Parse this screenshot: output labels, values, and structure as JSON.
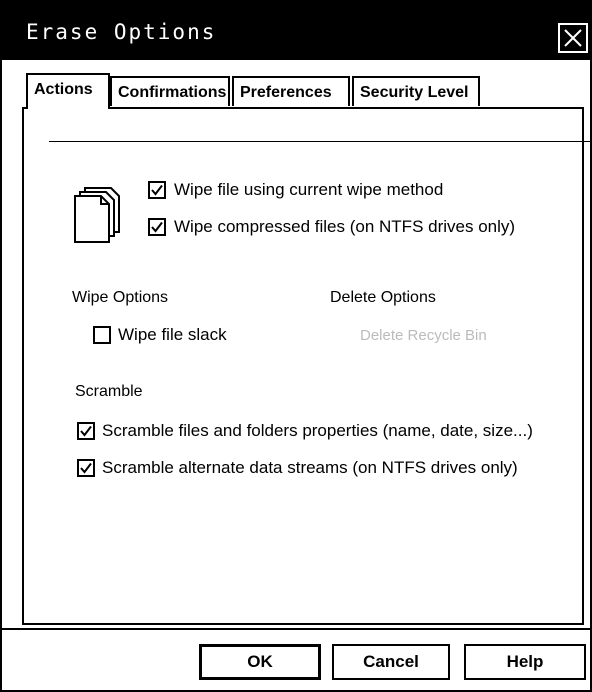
{
  "window": {
    "title": "Erase Options"
  },
  "tabs": [
    {
      "label": "Actions",
      "active": true
    },
    {
      "label": "Confirmations",
      "active": false
    },
    {
      "label": "Preferences",
      "active": false
    },
    {
      "label": "Security Level",
      "active": false
    }
  ],
  "actions": {
    "wipe_current_method": {
      "label": "Wipe file using current wipe method",
      "checked": true
    },
    "wipe_compressed": {
      "label": "Wipe compressed files (on NTFS drives only)",
      "checked": true
    },
    "wipe_options": {
      "heading": "Wipe Options",
      "wipe_slack": {
        "label": "Wipe file slack",
        "checked": false
      }
    },
    "delete_options": {
      "heading": "Delete Options",
      "delete_recycle_bin": {
        "label": "Delete Recycle Bin",
        "enabled": false
      }
    },
    "scramble": {
      "heading": "Scramble",
      "properties": {
        "label": "Scramble files and folders properties (name, date, size...)",
        "checked": true
      },
      "streams": {
        "label": "Scramble alternate data streams (on NTFS drives only)",
        "checked": true
      }
    }
  },
  "buttons": {
    "ok": "OK",
    "cancel": "Cancel",
    "help": "Help"
  }
}
